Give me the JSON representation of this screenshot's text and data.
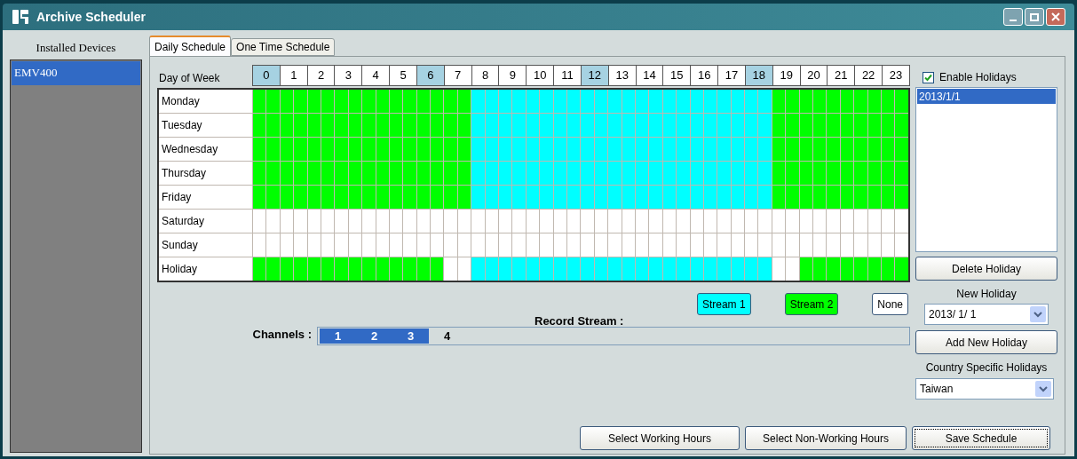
{
  "window": {
    "title": "Archive Scheduler"
  },
  "devices": {
    "title": "Installed Devices",
    "items": [
      {
        "label": "EMV400",
        "selected": true
      }
    ]
  },
  "tabs": [
    {
      "label": "Daily Schedule",
      "selected": true
    },
    {
      "label": "One Time Schedule",
      "selected": false
    }
  ],
  "schedule": {
    "corner_label": "Day of Week",
    "hours": [
      {
        "label": "0",
        "highlighted": true
      },
      {
        "label": "1",
        "highlighted": false
      },
      {
        "label": "2",
        "highlighted": false
      },
      {
        "label": "3",
        "highlighted": false
      },
      {
        "label": "4",
        "highlighted": false
      },
      {
        "label": "5",
        "highlighted": false
      },
      {
        "label": "6",
        "highlighted": true
      },
      {
        "label": "7",
        "highlighted": false
      },
      {
        "label": "8",
        "highlighted": false
      },
      {
        "label": "9",
        "highlighted": false
      },
      {
        "label": "10",
        "highlighted": false
      },
      {
        "label": "11",
        "highlighted": false
      },
      {
        "label": "12",
        "highlighted": true
      },
      {
        "label": "13",
        "highlighted": false
      },
      {
        "label": "14",
        "highlighted": false
      },
      {
        "label": "15",
        "highlighted": false
      },
      {
        "label": "16",
        "highlighted": false
      },
      {
        "label": "17",
        "highlighted": false
      },
      {
        "label": "18",
        "highlighted": true
      },
      {
        "label": "19",
        "highlighted": false
      },
      {
        "label": "20",
        "highlighted": false
      },
      {
        "label": "21",
        "highlighted": false
      },
      {
        "label": "22",
        "highlighted": false
      },
      {
        "label": "23",
        "highlighted": false
      }
    ],
    "rows": [
      {
        "day": "Monday",
        "slots": [
          {
            "kind": "stream2"
          },
          {
            "kind": "stream2"
          },
          {
            "kind": "stream2"
          },
          {
            "kind": "stream2"
          },
          {
            "kind": "stream2"
          },
          {
            "kind": "stream2"
          },
          {
            "kind": "stream2"
          },
          {
            "kind": "stream2"
          },
          {
            "kind": "stream2"
          },
          {
            "kind": "stream2"
          },
          {
            "kind": "stream2"
          },
          {
            "kind": "stream2"
          },
          {
            "kind": "stream2"
          },
          {
            "kind": "stream2"
          },
          {
            "kind": "stream2"
          },
          {
            "kind": "stream2"
          },
          {
            "kind": "stream1"
          },
          {
            "kind": "stream1"
          },
          {
            "kind": "stream1"
          },
          {
            "kind": "stream1"
          },
          {
            "kind": "stream1"
          },
          {
            "kind": "stream1"
          },
          {
            "kind": "stream1"
          },
          {
            "kind": "stream1"
          },
          {
            "kind": "stream1"
          },
          {
            "kind": "stream1"
          },
          {
            "kind": "stream1"
          },
          {
            "kind": "stream1"
          },
          {
            "kind": "stream1"
          },
          {
            "kind": "stream1"
          },
          {
            "kind": "stream1"
          },
          {
            "kind": "stream1"
          },
          {
            "kind": "stream1"
          },
          {
            "kind": "stream1"
          },
          {
            "kind": "stream1"
          },
          {
            "kind": "stream1"
          },
          {
            "kind": "stream1"
          },
          {
            "kind": "stream1"
          },
          {
            "kind": "stream2"
          },
          {
            "kind": "stream2"
          },
          {
            "kind": "stream2"
          },
          {
            "kind": "stream2"
          },
          {
            "kind": "stream2"
          },
          {
            "kind": "stream2"
          },
          {
            "kind": "stream2"
          },
          {
            "kind": "stream2"
          },
          {
            "kind": "stream2"
          },
          {
            "kind": "stream2"
          }
        ]
      },
      {
        "day": "Tuesday",
        "slots": [
          {
            "kind": "stream2"
          },
          {
            "kind": "stream2"
          },
          {
            "kind": "stream2"
          },
          {
            "kind": "stream2"
          },
          {
            "kind": "stream2"
          },
          {
            "kind": "stream2"
          },
          {
            "kind": "stream2"
          },
          {
            "kind": "stream2"
          },
          {
            "kind": "stream2"
          },
          {
            "kind": "stream2"
          },
          {
            "kind": "stream2"
          },
          {
            "kind": "stream2"
          },
          {
            "kind": "stream2"
          },
          {
            "kind": "stream2"
          },
          {
            "kind": "stream2"
          },
          {
            "kind": "stream2"
          },
          {
            "kind": "stream1"
          },
          {
            "kind": "stream1"
          },
          {
            "kind": "stream1"
          },
          {
            "kind": "stream1"
          },
          {
            "kind": "stream1"
          },
          {
            "kind": "stream1"
          },
          {
            "kind": "stream1"
          },
          {
            "kind": "stream1"
          },
          {
            "kind": "stream1"
          },
          {
            "kind": "stream1"
          },
          {
            "kind": "stream1"
          },
          {
            "kind": "stream1"
          },
          {
            "kind": "stream1"
          },
          {
            "kind": "stream1"
          },
          {
            "kind": "stream1"
          },
          {
            "kind": "stream1"
          },
          {
            "kind": "stream1"
          },
          {
            "kind": "stream1"
          },
          {
            "kind": "stream1"
          },
          {
            "kind": "stream1"
          },
          {
            "kind": "stream1"
          },
          {
            "kind": "stream1"
          },
          {
            "kind": "stream2"
          },
          {
            "kind": "stream2"
          },
          {
            "kind": "stream2"
          },
          {
            "kind": "stream2"
          },
          {
            "kind": "stream2"
          },
          {
            "kind": "stream2"
          },
          {
            "kind": "stream2"
          },
          {
            "kind": "stream2"
          },
          {
            "kind": "stream2"
          },
          {
            "kind": "stream2"
          }
        ]
      },
      {
        "day": "Wednesday",
        "slots": [
          {
            "kind": "stream2"
          },
          {
            "kind": "stream2"
          },
          {
            "kind": "stream2"
          },
          {
            "kind": "stream2"
          },
          {
            "kind": "stream2"
          },
          {
            "kind": "stream2"
          },
          {
            "kind": "stream2"
          },
          {
            "kind": "stream2"
          },
          {
            "kind": "stream2"
          },
          {
            "kind": "stream2"
          },
          {
            "kind": "stream2"
          },
          {
            "kind": "stream2"
          },
          {
            "kind": "stream2"
          },
          {
            "kind": "stream2"
          },
          {
            "kind": "stream2"
          },
          {
            "kind": "stream2"
          },
          {
            "kind": "stream1"
          },
          {
            "kind": "stream1"
          },
          {
            "kind": "stream1"
          },
          {
            "kind": "stream1"
          },
          {
            "kind": "stream1"
          },
          {
            "kind": "stream1"
          },
          {
            "kind": "stream1"
          },
          {
            "kind": "stream1"
          },
          {
            "kind": "stream1"
          },
          {
            "kind": "stream1"
          },
          {
            "kind": "stream1"
          },
          {
            "kind": "stream1"
          },
          {
            "kind": "stream1"
          },
          {
            "kind": "stream1"
          },
          {
            "kind": "stream1"
          },
          {
            "kind": "stream1"
          },
          {
            "kind": "stream1"
          },
          {
            "kind": "stream1"
          },
          {
            "kind": "stream1"
          },
          {
            "kind": "stream1"
          },
          {
            "kind": "stream1"
          },
          {
            "kind": "stream1"
          },
          {
            "kind": "stream2"
          },
          {
            "kind": "stream2"
          },
          {
            "kind": "stream2"
          },
          {
            "kind": "stream2"
          },
          {
            "kind": "stream2"
          },
          {
            "kind": "stream2"
          },
          {
            "kind": "stream2"
          },
          {
            "kind": "stream2"
          },
          {
            "kind": "stream2"
          },
          {
            "kind": "stream2"
          }
        ]
      },
      {
        "day": "Thursday",
        "slots": [
          {
            "kind": "stream2"
          },
          {
            "kind": "stream2"
          },
          {
            "kind": "stream2"
          },
          {
            "kind": "stream2"
          },
          {
            "kind": "stream2"
          },
          {
            "kind": "stream2"
          },
          {
            "kind": "stream2"
          },
          {
            "kind": "stream2"
          },
          {
            "kind": "stream2"
          },
          {
            "kind": "stream2"
          },
          {
            "kind": "stream2"
          },
          {
            "kind": "stream2"
          },
          {
            "kind": "stream2"
          },
          {
            "kind": "stream2"
          },
          {
            "kind": "stream2"
          },
          {
            "kind": "stream2"
          },
          {
            "kind": "stream1"
          },
          {
            "kind": "stream1"
          },
          {
            "kind": "stream1"
          },
          {
            "kind": "stream1"
          },
          {
            "kind": "stream1"
          },
          {
            "kind": "stream1"
          },
          {
            "kind": "stream1"
          },
          {
            "kind": "stream1"
          },
          {
            "kind": "stream1"
          },
          {
            "kind": "stream1"
          },
          {
            "kind": "stream1"
          },
          {
            "kind": "stream1"
          },
          {
            "kind": "stream1"
          },
          {
            "kind": "stream1"
          },
          {
            "kind": "stream1"
          },
          {
            "kind": "stream1"
          },
          {
            "kind": "stream1"
          },
          {
            "kind": "stream1"
          },
          {
            "kind": "stream1"
          },
          {
            "kind": "stream1"
          },
          {
            "kind": "stream1"
          },
          {
            "kind": "stream1"
          },
          {
            "kind": "stream2"
          },
          {
            "kind": "stream2"
          },
          {
            "kind": "stream2"
          },
          {
            "kind": "stream2"
          },
          {
            "kind": "stream2"
          },
          {
            "kind": "stream2"
          },
          {
            "kind": "stream2"
          },
          {
            "kind": "stream2"
          },
          {
            "kind": "stream2"
          },
          {
            "kind": "stream2"
          }
        ]
      },
      {
        "day": "Friday",
        "slots": [
          {
            "kind": "stream2"
          },
          {
            "kind": "stream2"
          },
          {
            "kind": "stream2"
          },
          {
            "kind": "stream2"
          },
          {
            "kind": "stream2"
          },
          {
            "kind": "stream2"
          },
          {
            "kind": "stream2"
          },
          {
            "kind": "stream2"
          },
          {
            "kind": "stream2"
          },
          {
            "kind": "stream2"
          },
          {
            "kind": "stream2"
          },
          {
            "kind": "stream2"
          },
          {
            "kind": "stream2"
          },
          {
            "kind": "stream2"
          },
          {
            "kind": "stream2"
          },
          {
            "kind": "stream2"
          },
          {
            "kind": "stream1"
          },
          {
            "kind": "stream1"
          },
          {
            "kind": "stream1"
          },
          {
            "kind": "stream1"
          },
          {
            "kind": "stream1"
          },
          {
            "kind": "stream1"
          },
          {
            "kind": "stream1"
          },
          {
            "kind": "stream1"
          },
          {
            "kind": "stream1"
          },
          {
            "kind": "stream1"
          },
          {
            "kind": "stream1"
          },
          {
            "kind": "stream1"
          },
          {
            "kind": "stream1"
          },
          {
            "kind": "stream1"
          },
          {
            "kind": "stream1"
          },
          {
            "kind": "stream1"
          },
          {
            "kind": "stream1"
          },
          {
            "kind": "stream1"
          },
          {
            "kind": "stream1"
          },
          {
            "kind": "stream1"
          },
          {
            "kind": "stream1"
          },
          {
            "kind": "stream1"
          },
          {
            "kind": "stream2"
          },
          {
            "kind": "stream2"
          },
          {
            "kind": "stream2"
          },
          {
            "kind": "stream2"
          },
          {
            "kind": "stream2"
          },
          {
            "kind": "stream2"
          },
          {
            "kind": "stream2"
          },
          {
            "kind": "stream2"
          },
          {
            "kind": "stream2"
          },
          {
            "kind": "stream2"
          }
        ]
      },
      {
        "day": "Saturday",
        "slots": [
          {
            "kind": "none"
          },
          {
            "kind": "none"
          },
          {
            "kind": "none"
          },
          {
            "kind": "none"
          },
          {
            "kind": "none"
          },
          {
            "kind": "none"
          },
          {
            "kind": "none"
          },
          {
            "kind": "none"
          },
          {
            "kind": "none"
          },
          {
            "kind": "none"
          },
          {
            "kind": "none"
          },
          {
            "kind": "none"
          },
          {
            "kind": "none"
          },
          {
            "kind": "none"
          },
          {
            "kind": "none"
          },
          {
            "kind": "none"
          },
          {
            "kind": "none"
          },
          {
            "kind": "none"
          },
          {
            "kind": "none"
          },
          {
            "kind": "none"
          },
          {
            "kind": "none"
          },
          {
            "kind": "none"
          },
          {
            "kind": "none"
          },
          {
            "kind": "none"
          },
          {
            "kind": "none"
          },
          {
            "kind": "none"
          },
          {
            "kind": "none"
          },
          {
            "kind": "none"
          },
          {
            "kind": "none"
          },
          {
            "kind": "none"
          },
          {
            "kind": "none"
          },
          {
            "kind": "none"
          },
          {
            "kind": "none"
          },
          {
            "kind": "none"
          },
          {
            "kind": "none"
          },
          {
            "kind": "none"
          },
          {
            "kind": "none"
          },
          {
            "kind": "none"
          },
          {
            "kind": "none"
          },
          {
            "kind": "none"
          },
          {
            "kind": "none"
          },
          {
            "kind": "none"
          },
          {
            "kind": "none"
          },
          {
            "kind": "none"
          },
          {
            "kind": "none"
          },
          {
            "kind": "none"
          },
          {
            "kind": "none"
          },
          {
            "kind": "none"
          }
        ]
      },
      {
        "day": "Sunday",
        "slots": [
          {
            "kind": "none"
          },
          {
            "kind": "none"
          },
          {
            "kind": "none"
          },
          {
            "kind": "none"
          },
          {
            "kind": "none"
          },
          {
            "kind": "none"
          },
          {
            "kind": "none"
          },
          {
            "kind": "none"
          },
          {
            "kind": "none"
          },
          {
            "kind": "none"
          },
          {
            "kind": "none"
          },
          {
            "kind": "none"
          },
          {
            "kind": "none"
          },
          {
            "kind": "none"
          },
          {
            "kind": "none"
          },
          {
            "kind": "none"
          },
          {
            "kind": "none"
          },
          {
            "kind": "none"
          },
          {
            "kind": "none"
          },
          {
            "kind": "none"
          },
          {
            "kind": "none"
          },
          {
            "kind": "none"
          },
          {
            "kind": "none"
          },
          {
            "kind": "none"
          },
          {
            "kind": "none"
          },
          {
            "kind": "none"
          },
          {
            "kind": "none"
          },
          {
            "kind": "none"
          },
          {
            "kind": "none"
          },
          {
            "kind": "none"
          },
          {
            "kind": "none"
          },
          {
            "kind": "none"
          },
          {
            "kind": "none"
          },
          {
            "kind": "none"
          },
          {
            "kind": "none"
          },
          {
            "kind": "none"
          },
          {
            "kind": "none"
          },
          {
            "kind": "none"
          },
          {
            "kind": "none"
          },
          {
            "kind": "none"
          },
          {
            "kind": "none"
          },
          {
            "kind": "none"
          },
          {
            "kind": "none"
          },
          {
            "kind": "none"
          },
          {
            "kind": "none"
          },
          {
            "kind": "none"
          },
          {
            "kind": "none"
          },
          {
            "kind": "none"
          }
        ]
      },
      {
        "day": "Holiday",
        "slots": [
          {
            "kind": "stream2"
          },
          {
            "kind": "stream2"
          },
          {
            "kind": "stream2"
          },
          {
            "kind": "stream2"
          },
          {
            "kind": "stream2"
          },
          {
            "kind": "stream2"
          },
          {
            "kind": "stream2"
          },
          {
            "kind": "stream2"
          },
          {
            "kind": "stream2"
          },
          {
            "kind": "stream2"
          },
          {
            "kind": "stream2"
          },
          {
            "kind": "stream2"
          },
          {
            "kind": "stream2"
          },
          {
            "kind": "stream2"
          },
          {
            "kind": "none"
          },
          {
            "kind": "none"
          },
          {
            "kind": "stream1"
          },
          {
            "kind": "stream1"
          },
          {
            "kind": "stream1"
          },
          {
            "kind": "stream1"
          },
          {
            "kind": "stream1"
          },
          {
            "kind": "stream1"
          },
          {
            "kind": "stream1"
          },
          {
            "kind": "stream1"
          },
          {
            "kind": "stream1"
          },
          {
            "kind": "stream1"
          },
          {
            "kind": "stream1"
          },
          {
            "kind": "stream1"
          },
          {
            "kind": "stream1"
          },
          {
            "kind": "stream1"
          },
          {
            "kind": "stream1"
          },
          {
            "kind": "stream1"
          },
          {
            "kind": "stream1"
          },
          {
            "kind": "stream1"
          },
          {
            "kind": "stream1"
          },
          {
            "kind": "stream1"
          },
          {
            "kind": "stream1"
          },
          {
            "kind": "stream1"
          },
          {
            "kind": "none"
          },
          {
            "kind": "none"
          },
          {
            "kind": "stream2"
          },
          {
            "kind": "stream2"
          },
          {
            "kind": "stream2"
          },
          {
            "kind": "stream2"
          },
          {
            "kind": "stream2"
          },
          {
            "kind": "stream2"
          },
          {
            "kind": "stream2"
          },
          {
            "kind": "stream2"
          }
        ]
      }
    ]
  },
  "record_stream": {
    "label": "Record Stream :",
    "options": [
      {
        "label": "Stream 1",
        "color": "#00ffff"
      },
      {
        "label": "Stream 2",
        "color": "#00ff00"
      },
      {
        "label": "None",
        "color": "#ffffff"
      }
    ]
  },
  "channels": {
    "label": "Channels :",
    "items": [
      {
        "label": "1",
        "selected": true
      },
      {
        "label": "2",
        "selected": true
      },
      {
        "label": "3",
        "selected": true
      },
      {
        "label": "4",
        "selected": false
      }
    ]
  },
  "holidays": {
    "enable_label": "Enable Holidays",
    "enabled": true,
    "list": [
      {
        "label": "2013/1/1",
        "selected": true
      }
    ],
    "delete_button": "Delete Holiday",
    "new_label": "New Holiday",
    "new_value": "2013/ 1/ 1",
    "add_button": "Add New Holiday",
    "country_label": "Country Specific Holidays",
    "country_value": "Taiwan"
  },
  "buttons": {
    "working": "Select Working Hours",
    "non_working": "Select Non-Working Hours",
    "save": "Save Schedule"
  }
}
